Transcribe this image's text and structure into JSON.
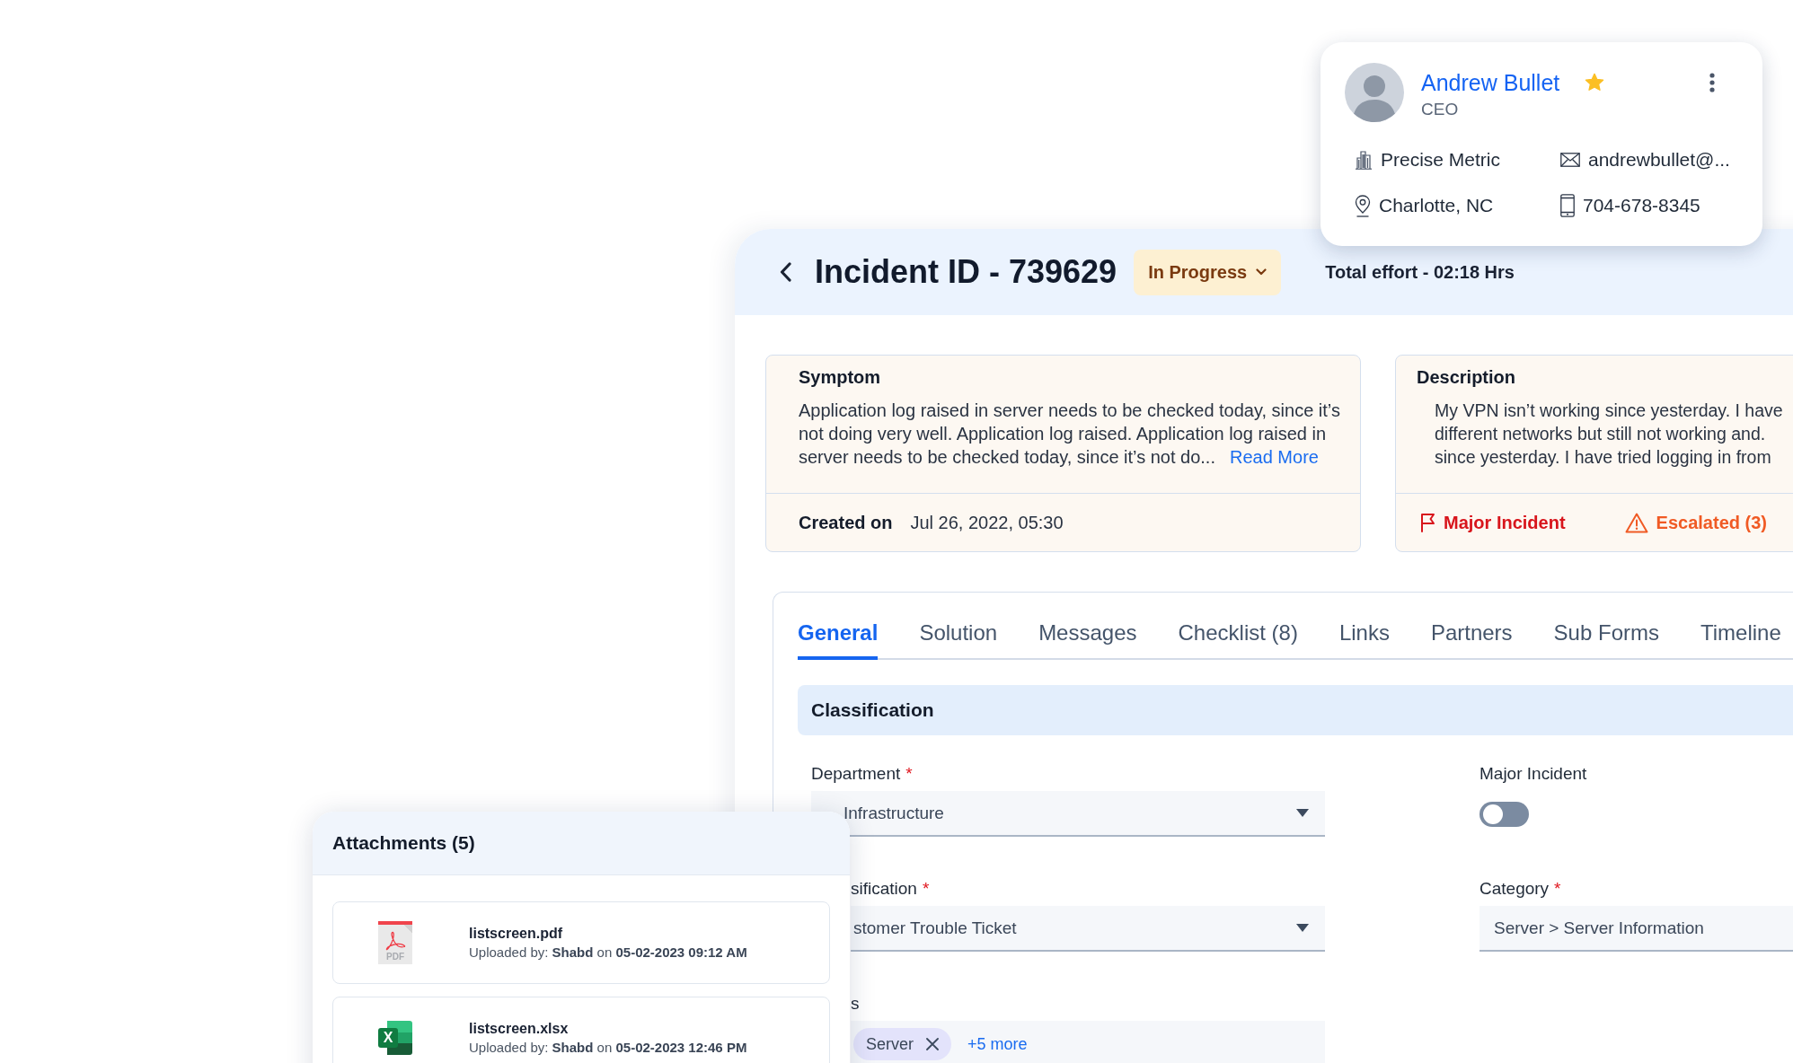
{
  "profile": {
    "name": "Andrew Bullet",
    "starred": true,
    "role": "CEO",
    "details": [
      {
        "kind": "company",
        "text": "Precise Metric"
      },
      {
        "kind": "email",
        "text": "andrewbullet@..."
      },
      {
        "kind": "location",
        "text": "Charlotte, NC"
      },
      {
        "kind": "phone",
        "text": "704-678-8345"
      }
    ]
  },
  "incident": {
    "title": "Incident ID - 739629",
    "status": "In Progress",
    "total_effort": "Total effort - 02:18 Hrs"
  },
  "symptom": {
    "heading": "Symptom",
    "text": "Application log raised in server needs to be checked today, since it’s not doing very well. Application log raised. Application log raised in server needs to be checked today, since it’s not do...",
    "link": "Read More",
    "created_label": "Created on",
    "created_value": "Jul 26, 2022, 05:30"
  },
  "description": {
    "heading": "Description",
    "lines": [
      "My VPN isn’t working since yesterday. I have",
      "different networks but still not working and.",
      "since yesterday. I have tried logging in from"
    ],
    "flags": [
      {
        "kind": "major",
        "label": "Major Incident"
      },
      {
        "kind": "escalated",
        "label": "Escalated (3)"
      }
    ]
  },
  "tabs": [
    {
      "label": "General",
      "selected": true
    },
    {
      "label": "Solution",
      "selected": false
    },
    {
      "label": "Messages",
      "selected": false
    },
    {
      "label": "Checklist (8)",
      "selected": false
    },
    {
      "label": "Links",
      "selected": false
    },
    {
      "label": "Partners",
      "selected": false
    },
    {
      "label": "Sub Forms",
      "selected": false
    },
    {
      "label": "Timeline",
      "selected": false
    }
  ],
  "section": {
    "title": "Classification",
    "fields": [
      {
        "kind": "select",
        "label": "Department",
        "required_mark": "*",
        "value": "Infrastructure"
      },
      {
        "kind": "toggle",
        "label": "Major Incident",
        "on": false
      },
      {
        "kind": "select",
        "label": "sification",
        "required_mark": "*",
        "value": "stomer Trouble Ticket"
      },
      {
        "kind": "text",
        "label": "Category",
        "required_mark": "*",
        "value": "Server > Server Information"
      },
      {
        "kind": "tags",
        "label": "s",
        "tags": [
          "Server"
        ],
        "more": "+5 more"
      }
    ]
  },
  "attachments": {
    "title": "Attachments (5)",
    "files": [
      {
        "kind": "pdf",
        "icon_label": "PDF",
        "name": "listscreen.pdf",
        "meta": "Uploaded by: **Shabd** on **05-02-2023 09:12 AM**"
      },
      {
        "kind": "xlsx",
        "icon_label": "X",
        "name": "listscreen.xlsx",
        "meta": "Uploaded by: **Shabd** on **05-02-2023 12:46 PM**"
      }
    ]
  }
}
